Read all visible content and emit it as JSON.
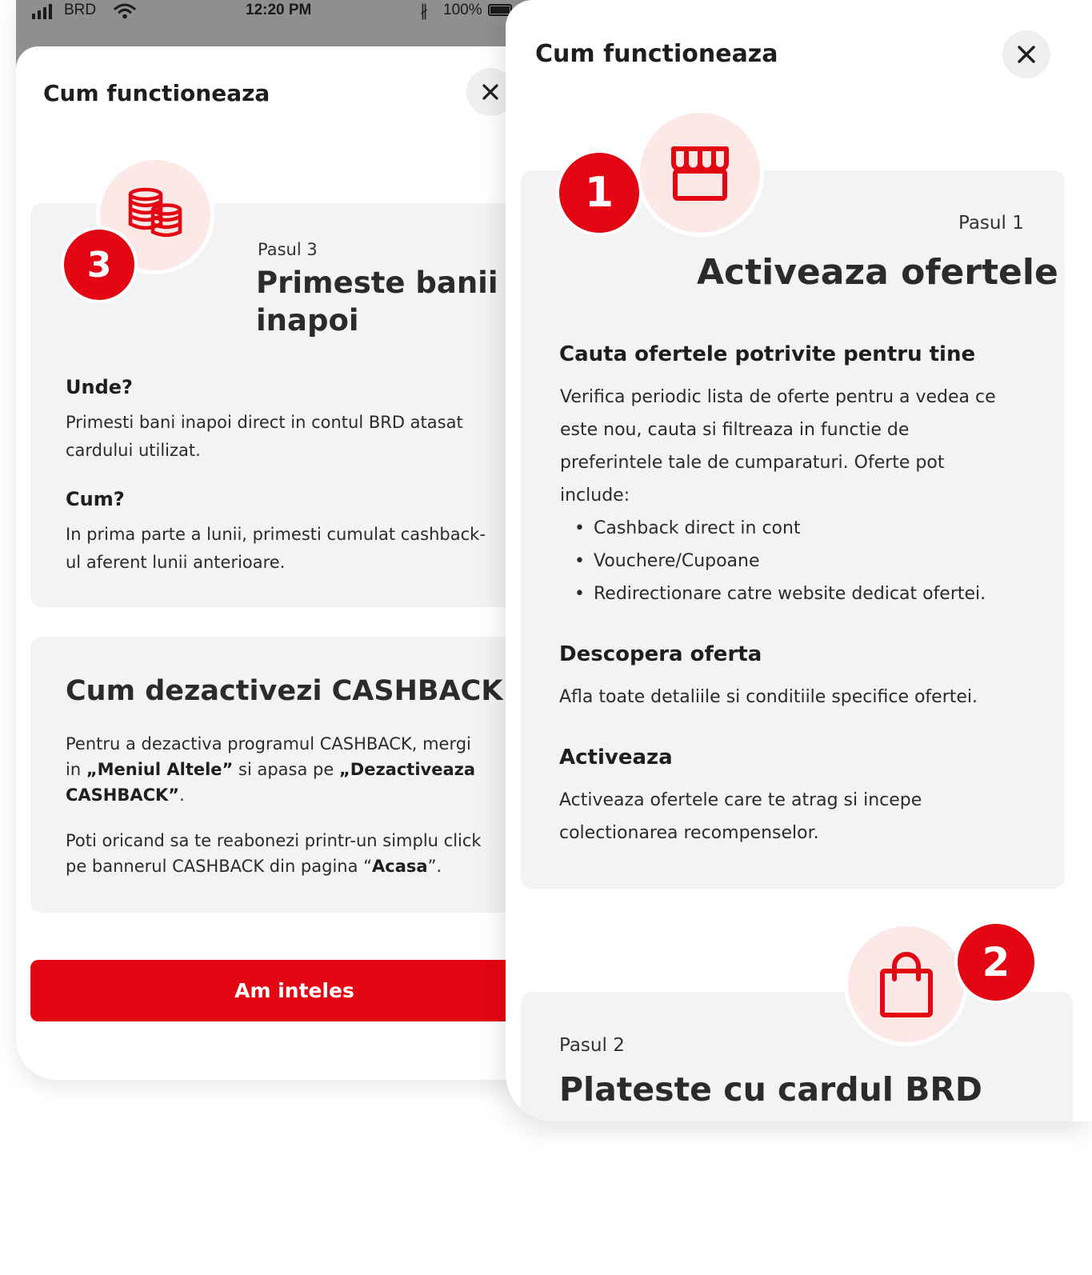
{
  "colors": {
    "brand_red": "#e30613",
    "card_bg": "#f3f3f3",
    "icon_bg": "#fde8e8",
    "status_bar": "#8f8f8f"
  },
  "status_bar": {
    "carrier": "BRD",
    "time": "12:20 PM",
    "battery": "100%",
    "icons": [
      "signal-icon",
      "wifi-icon",
      "bluetooth-icon",
      "battery-icon"
    ]
  },
  "left_sheet": {
    "title": "Cum functioneaza",
    "close_icon": "close-icon",
    "step3": {
      "badge": "3",
      "icon": "coins-stack-icon",
      "label": "Pasul 3",
      "title_line1": "Primeste banii",
      "title_line2": "inapoi",
      "where_heading": "Unde?",
      "where_text_1": "Primesti bani inapoi direct in contul BRD atasat",
      "where_text_2": "cardului utilizat.",
      "how_heading": "Cum?",
      "how_text_1": "In prima parte a lunii, primesti cumulat cashback-",
      "how_text_2": "ul aferent lunii anterioare."
    },
    "deactivate": {
      "title": "Cum dezactivezi CASHBACK",
      "p1_part1": "Pentru a dezactiva programul CASHBACK, mergi",
      "p1_part2": "in ",
      "p1_bold1": "„Meniul Altele”",
      "p1_part3": " si apasa pe ",
      "p1_bold2": "„Dezactiveaza",
      "p1_bold3": "CASHBACK”",
      "p1_part4": ".",
      "p2_line1": "Poti oricand sa te reabonezi printr-un simplu click",
      "p2_part1": "pe bannerul CASHBACK din pagina “",
      "p2_bold": "Acasa",
      "p2_part2": "”."
    },
    "button_label": "Am inteles"
  },
  "right_sheet": {
    "title": "Cum functioneaza",
    "close_icon": "close-icon",
    "step1": {
      "badge": "1",
      "icon": "store-icon",
      "label": "Pasul 1",
      "title": "Activeaza ofertele",
      "search_heading": "Cauta ofertele potrivite pentru tine",
      "search_text_lines": [
        "Verifica periodic lista de oferte pentru a vedea ce",
        "este nou, cauta si filtreaza in functie de",
        "preferintele tale de cumparaturi. Oferte pot",
        "include:"
      ],
      "bullets": [
        "Cashback direct in cont",
        "Vouchere/Cupoane",
        "Redirectionare catre website dedicat ofertei."
      ],
      "discover_heading": "Descopera oferta",
      "discover_text": "Afla toate detaliile si conditiile specifice ofertei.",
      "activate_heading": "Activeaza",
      "activate_text_1": "Activeaza ofertele care te atrag si incepe",
      "activate_text_2": "colectionarea recompenselor."
    },
    "step2": {
      "badge": "2",
      "icon": "shopping-bag-icon",
      "label": "Pasul 2",
      "title": "Plateste cu cardul BRD"
    }
  }
}
